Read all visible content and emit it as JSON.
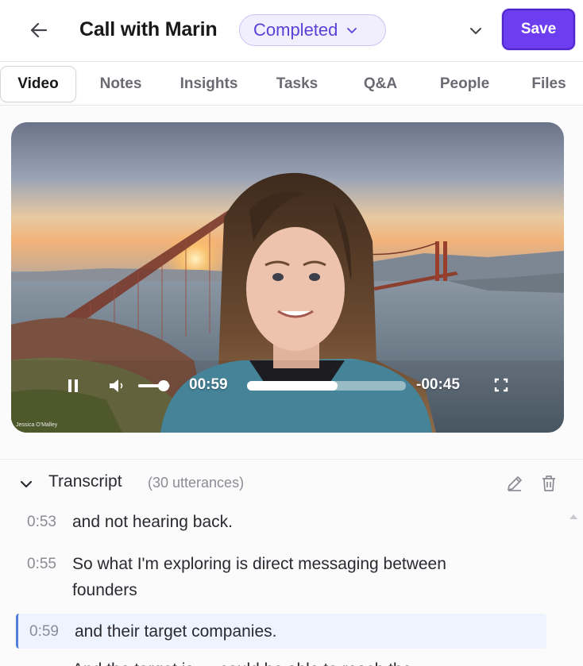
{
  "header": {
    "title": "Call with Marin",
    "status": "Completed",
    "save_label": "Save"
  },
  "tabs": [
    {
      "label": "Video"
    },
    {
      "label": "Notes"
    },
    {
      "label": "Insights"
    },
    {
      "label": "Tasks"
    },
    {
      "label": "Q&A"
    },
    {
      "label": "People"
    },
    {
      "label": "Files"
    }
  ],
  "video": {
    "current_time": "00:59",
    "remaining_time": "-00:45",
    "progress": 0.57,
    "volume": 0.8,
    "watermark": "Jessica O'Malley"
  },
  "transcript": {
    "title": "Transcript",
    "count": "(30 utterances)",
    "utterances": [
      {
        "time": "0:53",
        "text": "and not hearing back."
      },
      {
        "time": "0:55",
        "text": "So what I'm exploring is direct messaging between founders"
      },
      {
        "time": "0:59",
        "text": "and their target companies."
      },
      {
        "time": "",
        "text": "And the target is … could be able to reach the"
      }
    ]
  },
  "colors": {
    "accent": "#6d3df0",
    "status_bg": "#f1effe",
    "status_text": "#5b3fd6",
    "active_utterance_bg": "#eef4ff"
  },
  "icons": {
    "back": "arrow-left-icon",
    "status_chevron": "chevron-down-icon",
    "more": "chevron-down-icon",
    "play_pause": "pause-icon",
    "volume": "volume-icon",
    "fullscreen": "fullscreen-icon",
    "collapse": "chevron-down-icon",
    "edit": "pencil-icon",
    "delete": "trash-icon"
  }
}
